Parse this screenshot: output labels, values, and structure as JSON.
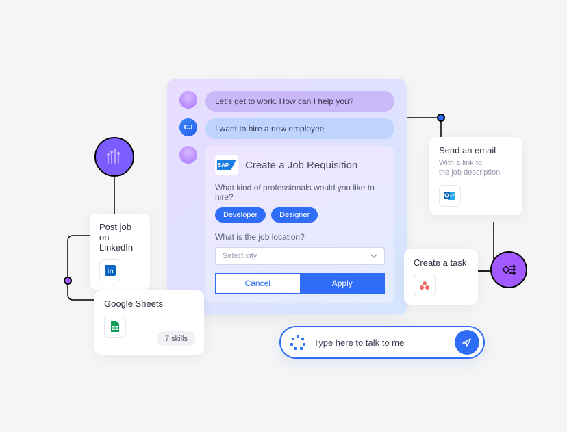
{
  "chat": {
    "bot1": "Let's get to work. How can I help you?",
    "user1": "I want to hire a new employee",
    "cj_label": "CJ"
  },
  "requisition": {
    "title": "Create a Job Requisition",
    "sap_label": "SAP",
    "q1": "What kind of professionals would you like to hire?",
    "role1": "Developer",
    "role2": "Designer",
    "q2": "What is the job location?",
    "select_placeholder": "Select city",
    "cancel": "Cancel",
    "apply": "Apply"
  },
  "cards": {
    "linkedin": {
      "line1": "Post job",
      "line2": "on LinkedIn"
    },
    "sheets": {
      "title": "Google Sheets",
      "skills": "7 skills"
    },
    "email": {
      "title": "Send an email",
      "sub1": "With a link to",
      "sub2": "the job description"
    },
    "task": {
      "title": "Create a task"
    }
  },
  "prompt": {
    "placeholder": "Type here to talk to me"
  }
}
